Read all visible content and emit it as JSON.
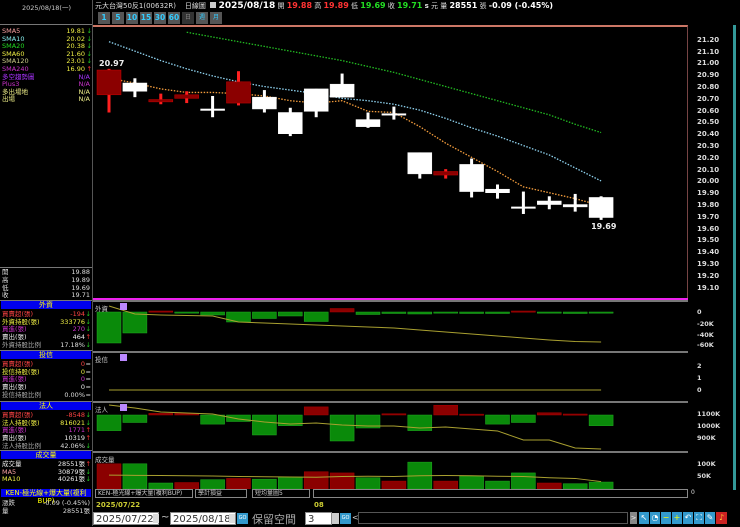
{
  "header": {
    "date_left": "2025/08/18(一)",
    "symbol": "元大台灣50反1(00632R)",
    "chart_type": "日線圖",
    "date": "2025/08/18",
    "open_label": "開",
    "open": "19.88",
    "high_label": "高",
    "high": "19.89",
    "low_label": "低",
    "low": "19.69",
    "close_label": "收",
    "close": "19.71",
    "s": "s",
    "unit": "元",
    "vol_label": "量",
    "volume": "28551",
    "vol_unit": "張",
    "change": "-0.09 (-0.45%)"
  },
  "period_buttons": [
    "1",
    "5",
    "10",
    "15",
    "30",
    "60",
    "日",
    "週",
    "月"
  ],
  "indicators": [
    {
      "label": "SMA5",
      "value": "19.81",
      "arrow": "↓",
      "color": "#f8a0a0",
      "acolor": "#2c2"
    },
    {
      "label": "SMA10",
      "value": "20.02",
      "arrow": "↓",
      "color": "#8ee",
      "acolor": "#2c2"
    },
    {
      "label": "SMA20",
      "value": "20.38",
      "arrow": "↓",
      "color": "#2d2",
      "acolor": "#2c2"
    },
    {
      "label": "SMA60",
      "value": "21.60",
      "arrow": "↓",
      "color": "#ee4",
      "acolor": "#2c2"
    },
    {
      "label": "SMA120",
      "value": "23.01",
      "arrow": "↓",
      "color": "#cc8",
      "acolor": "#2c2"
    },
    {
      "label": "SMA240",
      "value": "16.90",
      "arrow": "↑",
      "color": "#c3c",
      "acolor": "#f33"
    },
    {
      "label": "多空趨勢圖",
      "value": "N/A",
      "arrow": "",
      "color": "#a3f",
      "acolor": "#fff"
    },
    {
      "label": "Plus3",
      "value": "N/A",
      "arrow": "",
      "color": "#c3c",
      "acolor": "#fff"
    },
    {
      "label": "多出場地",
      "value": "N/A",
      "arrow": "",
      "color": "#ee8",
      "acolor": "#fff"
    },
    {
      "label": "出場",
      "value": "N/A",
      "arrow": "",
      "color": "#ee8",
      "acolor": "#fff"
    }
  ],
  "ohlc_panel": [
    {
      "label": "開",
      "value": "19.88"
    },
    {
      "label": "高",
      "value": "19.89"
    },
    {
      "label": "低",
      "value": "19.69"
    },
    {
      "label": "收",
      "value": "19.71"
    }
  ],
  "sections": [
    {
      "title": "外資",
      "rows": [
        {
          "label": "買賣超(張)",
          "value": "-194",
          "arrow": "↓",
          "lc": "#f44",
          "vc": "#f44",
          "ac": "#2c2"
        },
        {
          "label": "外資持股(張)",
          "value": "333776",
          "arrow": "↓",
          "lc": "#ee4",
          "vc": "#ee4",
          "ac": "#2c2"
        },
        {
          "label": "買進(張)",
          "value": "270",
          "arrow": "↓",
          "lc": "#c3c",
          "vc": "#c3c",
          "ac": "#2c2"
        },
        {
          "label": "賣出(張)",
          "value": "464",
          "arrow": "↑",
          "lc": "#eee",
          "vc": "#eee",
          "ac": "#f33"
        },
        {
          "label": "外資持股比例",
          "value": "17.18%",
          "arrow": "↓",
          "lc": "#aaa",
          "vc": "#ddd",
          "ac": "#2c2"
        }
      ]
    },
    {
      "title": "投信",
      "rows": [
        {
          "label": "買賣超(張)",
          "value": "0",
          "arrow": "=",
          "lc": "#f44",
          "vc": "#f44",
          "ac": "#ddd"
        },
        {
          "label": "投信持股(張)",
          "value": "0",
          "arrow": "=",
          "lc": "#ee4",
          "vc": "#ee4",
          "ac": "#ddd"
        },
        {
          "label": "買進(張)",
          "value": "0",
          "arrow": "=",
          "lc": "#c3c",
          "vc": "#c3c",
          "ac": "#ddd"
        },
        {
          "label": "賣出(張)",
          "value": "0",
          "arrow": "=",
          "lc": "#eee",
          "vc": "#eee",
          "ac": "#ddd"
        },
        {
          "label": "投信持股比例",
          "value": "0.00%",
          "arrow": "=",
          "lc": "#aaa",
          "vc": "#ddd",
          "ac": "#ddd"
        }
      ]
    },
    {
      "title": "法人",
      "rows": [
        {
          "label": "買賣超(張)",
          "value": "-8548",
          "arrow": "↓",
          "lc": "#f44",
          "vc": "#f44",
          "ac": "#2c2"
        },
        {
          "label": "法人持股(張)",
          "value": "816021",
          "arrow": "↓",
          "lc": "#ee4",
          "vc": "#ee4",
          "ac": "#2c2"
        },
        {
          "label": "買進(張)",
          "value": "1771",
          "arrow": "↑",
          "lc": "#c3c",
          "vc": "#c3c",
          "ac": "#f33"
        },
        {
          "label": "賣出(張)",
          "value": "10319",
          "arrow": "↑",
          "lc": "#eee",
          "vc": "#eee",
          "ac": "#f33"
        },
        {
          "label": "法人持股比例",
          "value": "42.06%",
          "arrow": "↓",
          "lc": "#aaa",
          "vc": "#ddd",
          "ac": "#2c2"
        }
      ]
    },
    {
      "title": "成交量",
      "rows": [
        {
          "label": "成交量",
          "value": "28551張",
          "arrow": "↑",
          "lc": "#eee",
          "vc": "#eee",
          "ac": "#f33"
        },
        {
          "label": "MA5",
          "value": "30879張",
          "arrow": "↓",
          "lc": "#f8a0a0",
          "vc": "#eee",
          "ac": "#2c2"
        },
        {
          "label": "MA10",
          "value": "40261張",
          "arrow": "↓",
          "lc": "#ee4",
          "vc": "#eee",
          "ac": "#2c2"
        }
      ]
    }
  ],
  "strategy": {
    "title": "KEN-極光線+爆大量(複利BUP)",
    "change_label": "漲跌",
    "change": "-0.09 (-0.45%)",
    "vol_label": "量",
    "volume": "28551張"
  },
  "panel_labels": {
    "foreign": "外資",
    "trust": "投信",
    "inst": "法人",
    "volume": "成交量"
  },
  "selectors": [
    "KEN-極光線+爆大量(複利BUP)",
    "學計損益",
    "短均量圖5"
  ],
  "date_axis": {
    "start": "2025/07/22",
    "mid": "08"
  },
  "range": {
    "from": "2025/07/22",
    "tilde": "~",
    "to": "2025/08/18",
    "go": "GO",
    "reserve_label": "保留空間",
    "reserve": "3",
    "prev": "<",
    "next": ">"
  },
  "colors": {
    "up": "#8b0000",
    "up_wick": "#ff2020",
    "down": "#ffffff",
    "sma5": "#f39c3c",
    "sma10": "#8fd3f0",
    "sma20": "#22bb22",
    "bar_up": "#8b0000",
    "bar_down": "#0a8a0a"
  },
  "chart_data": [
    {
      "type": "candlestick",
      "title": "",
      "ylim": [
        19.05,
        21.25
      ],
      "y_ticks": [
        "21.20",
        "21.10",
        "21.00",
        "20.90",
        "20.80",
        "20.70",
        "20.60",
        "20.50",
        "20.40",
        "20.30",
        "20.20",
        "20.10",
        "20.00",
        "19.90",
        "19.80",
        "19.70",
        "19.60",
        "19.50",
        "19.40",
        "19.30",
        "19.20",
        "19.10"
      ],
      "candles": [
        {
          "o": 20.75,
          "h": 20.97,
          "l": 20.6,
          "c": 20.96
        },
        {
          "o": 20.85,
          "h": 20.89,
          "l": 20.73,
          "c": 20.78
        },
        {
          "o": 20.69,
          "h": 20.76,
          "l": 20.67,
          "c": 20.71
        },
        {
          "o": 20.72,
          "h": 20.78,
          "l": 20.68,
          "c": 20.75
        },
        {
          "o": 20.63,
          "h": 20.74,
          "l": 20.56,
          "c": 20.63
        },
        {
          "o": 20.68,
          "h": 20.95,
          "l": 20.66,
          "c": 20.86
        },
        {
          "o": 20.73,
          "h": 20.79,
          "l": 20.6,
          "c": 20.63
        },
        {
          "o": 20.6,
          "h": 20.64,
          "l": 20.4,
          "c": 20.42
        },
        {
          "o": 20.8,
          "h": 20.8,
          "l": 20.56,
          "c": 20.61
        },
        {
          "o": 20.84,
          "h": 20.93,
          "l": 20.73,
          "c": 20.73
        },
        {
          "o": 20.54,
          "h": 20.6,
          "l": 20.47,
          "c": 20.48
        },
        {
          "o": 20.59,
          "h": 20.65,
          "l": 20.54,
          "c": 20.58
        },
        {
          "o": 20.26,
          "h": 20.26,
          "l": 20.04,
          "c": 20.08
        },
        {
          "o": 20.07,
          "h": 20.12,
          "l": 20.04,
          "c": 20.1
        },
        {
          "o": 20.16,
          "h": 20.21,
          "l": 19.88,
          "c": 19.93
        },
        {
          "o": 19.95,
          "h": 19.99,
          "l": 19.87,
          "c": 19.92
        },
        {
          "o": 19.8,
          "h": 19.93,
          "l": 19.74,
          "c": 19.8
        },
        {
          "o": 19.85,
          "h": 19.89,
          "l": 19.78,
          "c": 19.82
        },
        {
          "o": 19.82,
          "h": 19.91,
          "l": 19.76,
          "c": 19.8
        },
        {
          "o": 19.88,
          "h": 19.89,
          "l": 19.69,
          "c": 19.71
        }
      ],
      "high_label": "20.97",
      "low_label": "19.69",
      "sma5": [
        20.89,
        20.85,
        20.8,
        20.77,
        20.77,
        20.76,
        20.74,
        20.7,
        20.68,
        20.7,
        20.61,
        20.6,
        20.48,
        20.34,
        20.22,
        20.1,
        19.97,
        19.92,
        19.87,
        19.81
      ],
      "sma10": [
        21.2,
        21.12,
        21.04,
        20.97,
        20.91,
        20.86,
        20.82,
        20.79,
        20.76,
        20.72,
        20.7,
        20.67,
        20.62,
        20.55,
        20.47,
        20.4,
        20.32,
        20.24,
        20.13,
        20.02
      ],
      "sma20": [
        null,
        null,
        null,
        21.28,
        21.24,
        21.2,
        21.16,
        21.12,
        21.08,
        21.04,
        20.99,
        20.94,
        20.88,
        20.82,
        20.76,
        20.7,
        20.64,
        20.58,
        20.5,
        20.43
      ]
    },
    {
      "type": "bar",
      "title": "外資",
      "y_ticks": [
        "0",
        "-20K",
        "-40K",
        "-60K"
      ],
      "ylim": [
        -64000,
        20000
      ],
      "values": [
        -62000,
        -42000,
        2000,
        -1000,
        -6000,
        -20000,
        -13000,
        -8000,
        -19000,
        7000,
        -5000,
        -3000,
        -4000,
        -2000,
        -3000,
        -3000,
        2000,
        -2000,
        -3000,
        -2000
      ],
      "line": [
        12000,
        -4000,
        -6000,
        -7000,
        -8000,
        -20000,
        -22000,
        -24000,
        -26000,
        -28000,
        -30000,
        -32000,
        -36000,
        -40000,
        -44000,
        -48000,
        -52000,
        -56000,
        -59000,
        -60000
      ]
    },
    {
      "type": "bar",
      "title": "投信",
      "y_ticks": [
        "2",
        "1",
        "0"
      ],
      "ylim": [
        -0.5,
        3
      ],
      "values": [
        0,
        0,
        0,
        0,
        0,
        0,
        0,
        0,
        0,
        0,
        0,
        0,
        0,
        0,
        0,
        0,
        0,
        0,
        0,
        0
      ],
      "line": [
        0,
        0,
        0,
        0,
        0,
        0,
        0,
        0,
        0,
        0,
        0,
        0,
        0,
        0,
        0,
        0,
        0,
        0,
        0,
        0
      ]
    },
    {
      "type": "bar",
      "title": "法人",
      "y_ticks": [
        "1100K",
        "1000K",
        "900K"
      ],
      "values": [
        -12500,
        -6000,
        1300,
        1300,
        -7300,
        -5200,
        -16000,
        -8600,
        6500,
        -20800,
        -10400,
        1000,
        -12500,
        7800,
        700,
        -7300,
        -6000,
        1800,
        800,
        -8548
      ],
      "line": [
        1183000,
        1158000,
        1125000,
        1117000,
        1108000,
        1067000,
        1042000,
        1025000,
        1033000,
        1017000,
        1008000,
        1008000,
        992000,
        1000000,
        983000,
        967000,
        892000,
        892000,
        825000,
        817000
      ]
    },
    {
      "type": "bar",
      "title": "成交量",
      "y_ticks": [
        "100K",
        "50K"
      ],
      "ylim": [
        0,
        130000
      ],
      "values": [
        105000,
        105000,
        25000,
        27000,
        39000,
        44000,
        41000,
        50000,
        72000,
        67000,
        47000,
        33000,
        112000,
        33000,
        54000,
        33000,
        67000,
        25000,
        22000,
        29000
      ],
      "up": [
        true,
        false,
        false,
        true,
        false,
        true,
        false,
        false,
        true,
        true,
        false,
        true,
        false,
        true,
        false,
        false,
        false,
        true,
        false,
        false
      ],
      "ma5": [
        58000,
        57000,
        56000,
        55000,
        54000,
        52000,
        51000,
        50000,
        49000,
        52000,
        53000,
        52000,
        55000,
        56000,
        55000,
        53000,
        52000,
        47000,
        44000,
        31000
      ]
    }
  ],
  "toolbar_icons": [
    "collapse-icon",
    "pointer-icon",
    "clock-icon",
    "zoom-out-icon",
    "zoom-in-icon",
    "undo-icon",
    "fit-icon",
    "draw-icon",
    "alert-icon"
  ]
}
